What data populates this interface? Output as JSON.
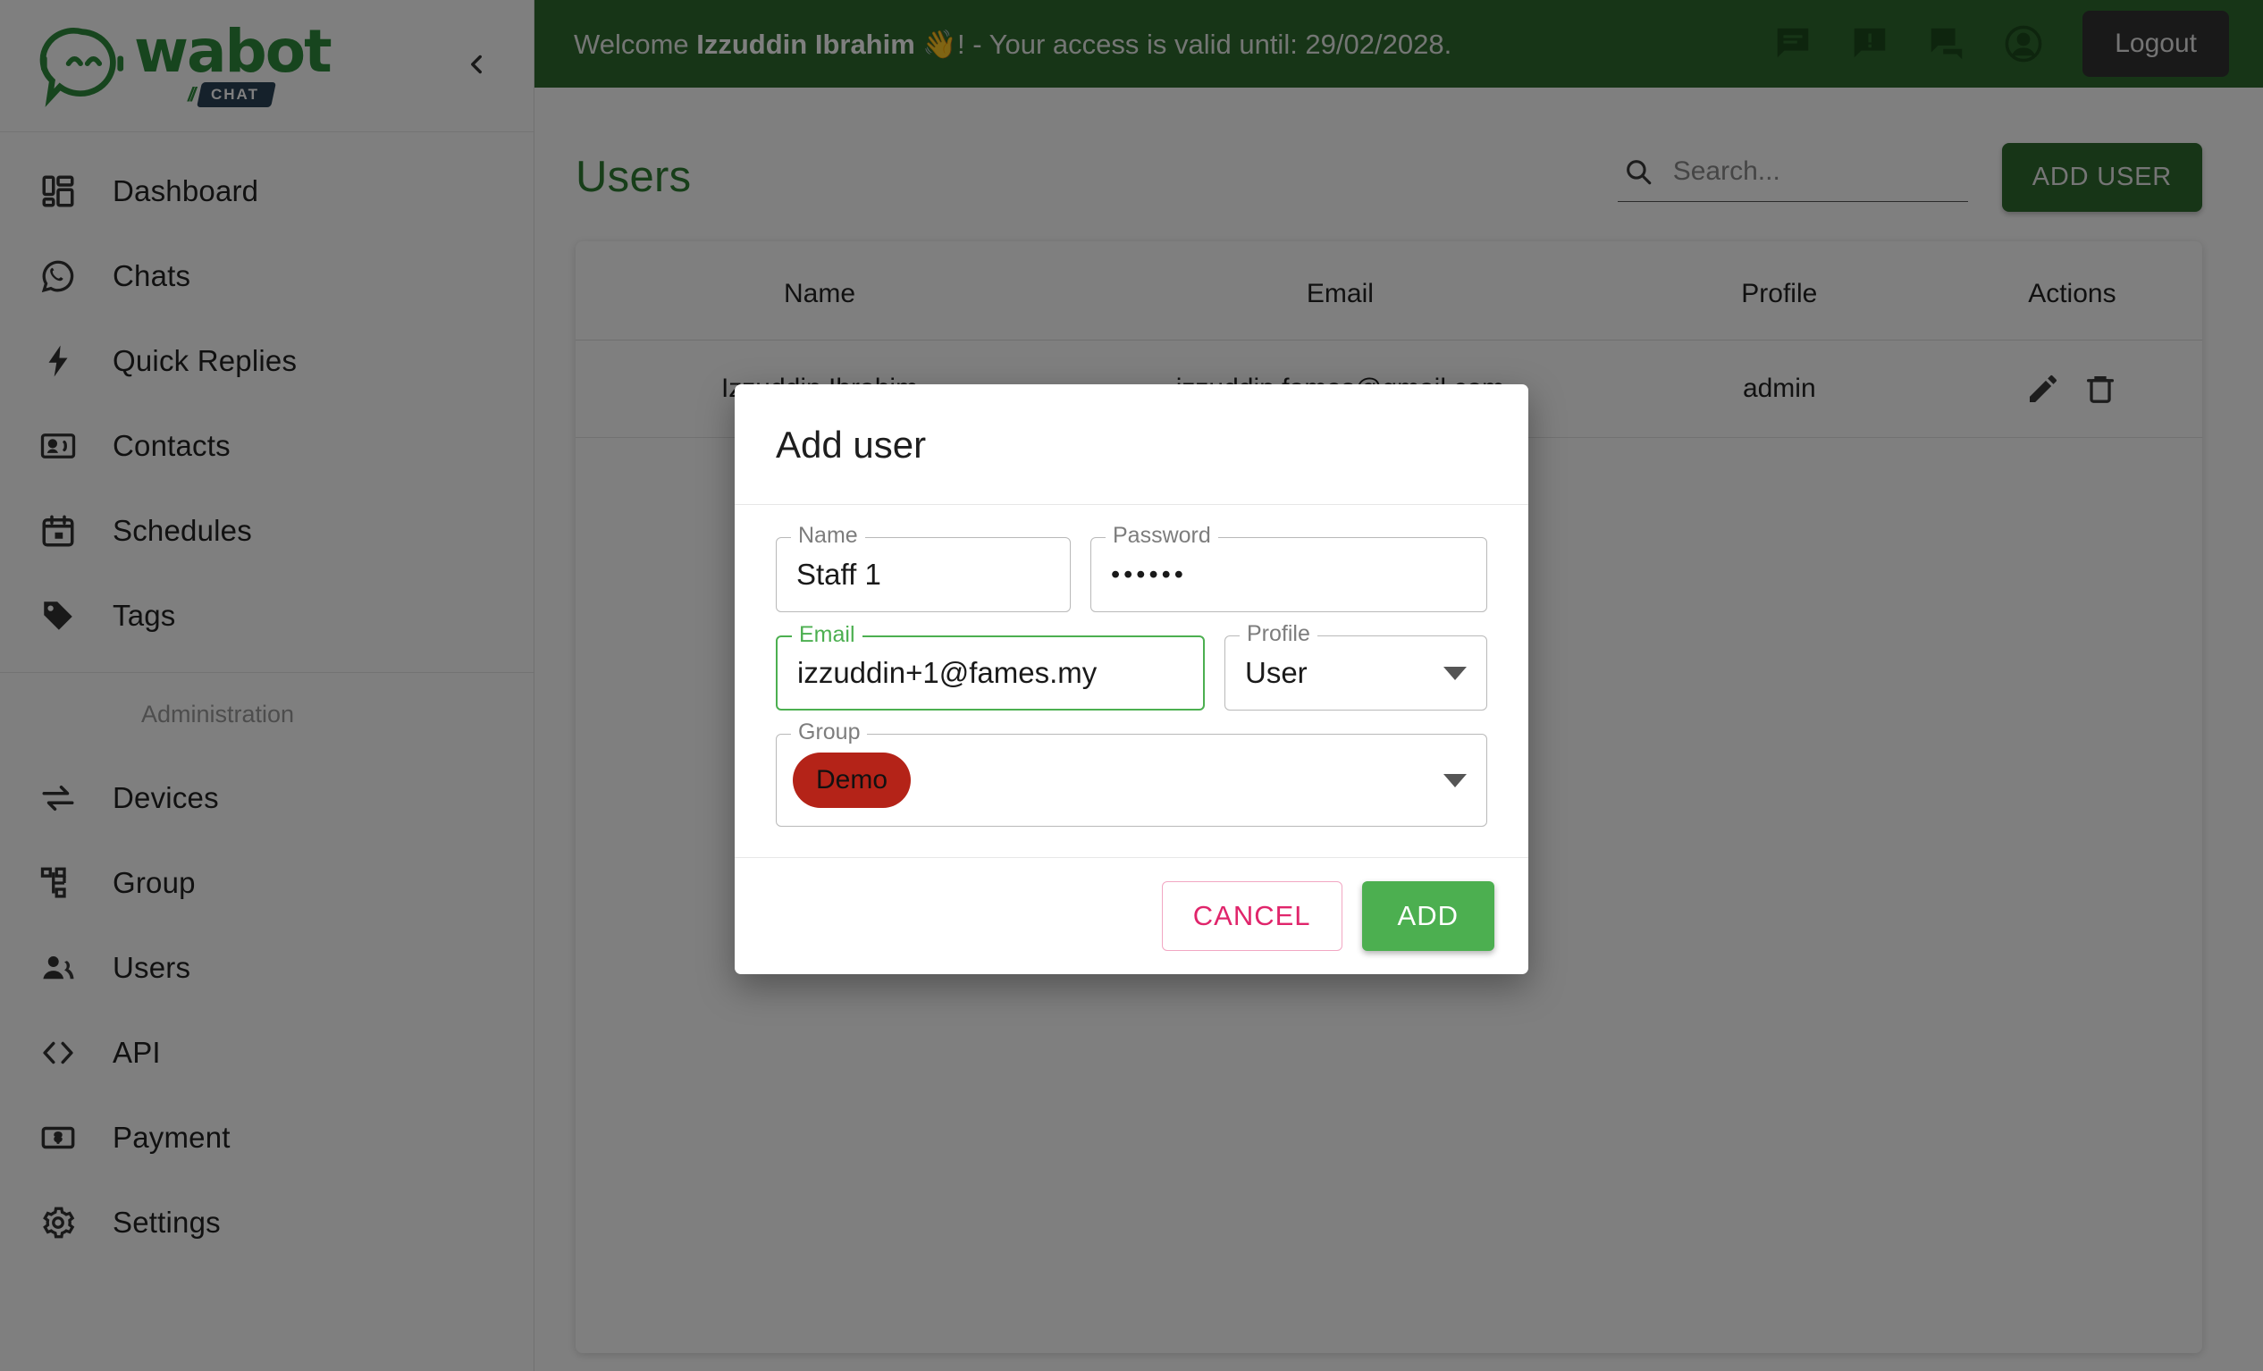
{
  "brand": {
    "name": "wabot",
    "badge": "CHAT",
    "logo_color": "#2e8b3c",
    "badge_bg": "#2b4356"
  },
  "sidebar": {
    "collapse_icon": "chevron-left-icon",
    "items": [
      {
        "label": "Dashboard",
        "icon": "dashboard-icon"
      },
      {
        "label": "Chats",
        "icon": "whatsapp-icon"
      },
      {
        "label": "Quick Replies",
        "icon": "bolt-icon"
      },
      {
        "label": "Contacts",
        "icon": "contact-card-icon"
      },
      {
        "label": "Tags",
        "icon": "tag-icon"
      }
    ],
    "section_title": "Administration",
    "admin_items": [
      {
        "label": "Devices",
        "icon": "swap-horizontal-icon"
      },
      {
        "label": "Group",
        "icon": "hierarchy-icon"
      },
      {
        "label": "Users",
        "icon": "people-icon"
      },
      {
        "label": "API",
        "icon": "code-brackets-icon"
      },
      {
        "label": "Payment",
        "icon": "money-icon"
      },
      {
        "label": "Settings",
        "icon": "gear-icon"
      }
    ]
  },
  "topbar": {
    "welcome_prefix": "Welcome ",
    "user_name": "Izzuddin Ibrahim",
    "welcome_suffix": " 👋! - Your access is valid until: 29/02/2028.",
    "bg_color": "#2f6b2f",
    "icons": [
      {
        "name": "message-lines-icon"
      },
      {
        "name": "alert-chat-icon"
      },
      {
        "name": "forum-icon"
      },
      {
        "name": "account-circle-icon"
      }
    ],
    "logout_label": "Logout"
  },
  "page": {
    "title": "Users",
    "title_color": "#2e7d32",
    "search": {
      "placeholder": "Search...",
      "value": "",
      "icon": "search-icon"
    },
    "add_user_label": "ADD USER"
  },
  "table": {
    "columns": [
      "Name",
      "Email",
      "Profile",
      "Actions"
    ],
    "rows": [
      {
        "name": "Izzuddin Ibrahim",
        "email": "izzuddin.fames@gmail.com",
        "profile": "admin",
        "actions": [
          "edit-pencil-icon",
          "delete-trash-icon"
        ]
      }
    ]
  },
  "modal": {
    "title": "Add user",
    "fields": {
      "name": {
        "label": "Name",
        "value": "Staff 1"
      },
      "password": {
        "label": "Password",
        "value": "••••••"
      },
      "email": {
        "label": "Email",
        "value": "izzuddin+1@fames.my",
        "focused": true,
        "focus_color": "#4caf50"
      },
      "profile": {
        "label": "Profile",
        "value": "User"
      },
      "group": {
        "label": "Group",
        "chip": "Demo",
        "chip_color": "#b42318"
      }
    },
    "cancel_label": "CANCEL",
    "add_label": "ADD"
  }
}
